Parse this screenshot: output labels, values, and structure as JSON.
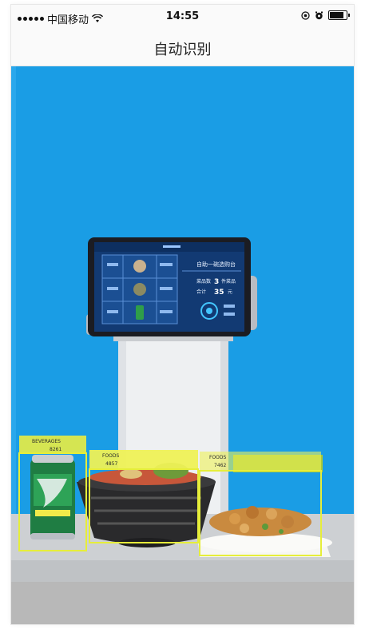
{
  "status_bar": {
    "carrier": "中国移动",
    "time": "14:55",
    "battery_level": 0.85
  },
  "navbar": {
    "title": "自动识别"
  },
  "screen": {
    "header_text": "自助一碗选购台",
    "line1_prefix": "菜品数",
    "line1_value": "3",
    "line1_suffix": "件菜品",
    "line2_prefix": "合计",
    "line2_value": "35",
    "line2_suffix": "元"
  },
  "detections": [
    {
      "label": "BEVERAGES",
      "score": "8261"
    },
    {
      "label": "FOODS",
      "score": "4857"
    },
    {
      "label": "FOODS",
      "score": "7462"
    }
  ],
  "colors": {
    "background_blue": "#1a9de5",
    "box_yellow": "#e6ee3a"
  }
}
